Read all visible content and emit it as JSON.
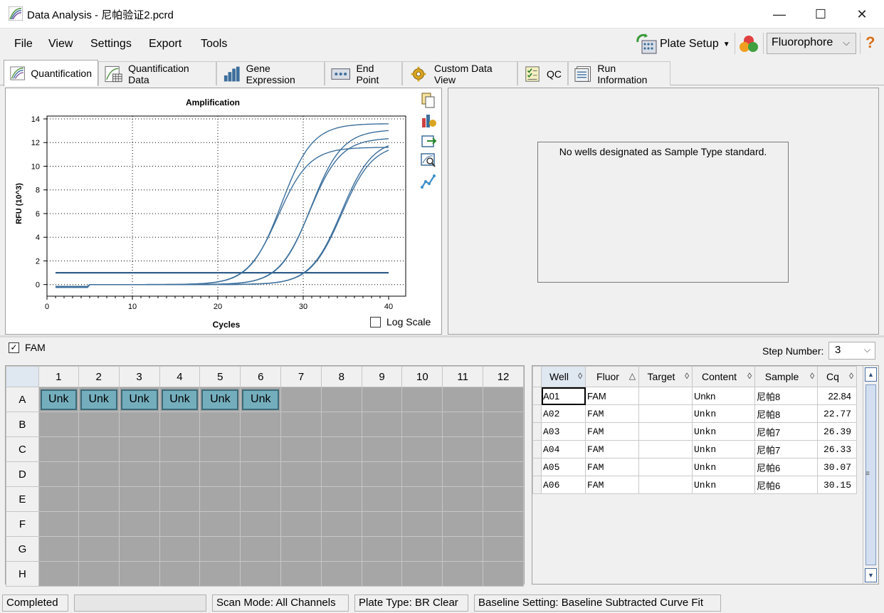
{
  "window": {
    "title": "Data Analysis - 尼帕验证2.pcrd",
    "minimize": "—",
    "maximize": "☐",
    "close": "✕"
  },
  "menu": [
    "File",
    "View",
    "Settings",
    "Export",
    "Tools"
  ],
  "toolbar": {
    "plate_setup_label": "Plate Setup",
    "fluor_select_value": "Fluorophore",
    "help_glyph": "?"
  },
  "tabs": [
    {
      "label": "Quantification",
      "active": true
    },
    {
      "label": "Quantification Data",
      "active": false
    },
    {
      "label": "Gene Expression",
      "active": false
    },
    {
      "label": "End Point",
      "active": false
    },
    {
      "label": "Custom Data View",
      "active": false
    },
    {
      "label": "QC",
      "active": false
    },
    {
      "label": "Run Information",
      "active": false
    }
  ],
  "chart_data": {
    "type": "line",
    "title": "Amplification",
    "xlabel": "Cycles",
    "ylabel": "RFU (10^3)",
    "xlim": [
      0,
      40
    ],
    "ylim": [
      -0.5,
      14
    ],
    "xticks": [
      0,
      10,
      20,
      30,
      40
    ],
    "yticks": [
      0,
      2,
      4,
      6,
      8,
      10,
      12,
      14
    ],
    "grid": true,
    "threshold": 1.0,
    "series_color": "#3d6f9c",
    "threshold_color": "#1f4f7f",
    "curve_params": [
      {
        "cq": 22.84,
        "plateau": 13.6
      },
      {
        "cq": 22.77,
        "plateau": 11.6
      },
      {
        "cq": 26.39,
        "plateau": 13.1
      },
      {
        "cq": 26.33,
        "plateau": 12.4
      },
      {
        "cq": 30.07,
        "plateau": 12.3
      },
      {
        "cq": 30.15,
        "plateau": 11.9
      }
    ]
  },
  "log_scale": {
    "label": "Log Scale",
    "checked": false
  },
  "standard_panel": {
    "message": "No wells designated as Sample Type standard."
  },
  "fluor_filter": {
    "label": "FAM",
    "checked": true,
    "check_glyph": "✓"
  },
  "step_number": {
    "label": "Step Number:",
    "value": "3"
  },
  "plate": {
    "columns": [
      "1",
      "2",
      "3",
      "4",
      "5",
      "6",
      "7",
      "8",
      "9",
      "10",
      "11",
      "12"
    ],
    "rows": [
      "A",
      "B",
      "C",
      "D",
      "E",
      "F",
      "G",
      "H"
    ],
    "wells": {
      "A1": "Unk",
      "A2": "Unk",
      "A3": "Unk",
      "A4": "Unk",
      "A5": "Unk",
      "A6": "Unk"
    }
  },
  "well_table": {
    "columns": [
      "Well",
      "Fluor",
      "Target",
      "Content",
      "Sample",
      "Cq"
    ],
    "rows": [
      {
        "well": "A01",
        "fluor": "FAM",
        "target": "",
        "content": "Unkn",
        "sample": "尼帕8",
        "cq": "22.84"
      },
      {
        "well": "A02",
        "fluor": "FAM",
        "target": "",
        "content": "Unkn",
        "sample": "尼帕8",
        "cq": "22.77"
      },
      {
        "well": "A03",
        "fluor": "FAM",
        "target": "",
        "content": "Unkn",
        "sample": "尼帕7",
        "cq": "26.39"
      },
      {
        "well": "A04",
        "fluor": "FAM",
        "target": "",
        "content": "Unkn",
        "sample": "尼帕7",
        "cq": "26.33"
      },
      {
        "well": "A05",
        "fluor": "FAM",
        "target": "",
        "content": "Unkn",
        "sample": "尼帕6",
        "cq": "30.07"
      },
      {
        "well": "A06",
        "fluor": "FAM",
        "target": "",
        "content": "Unkn",
        "sample": "尼帕6",
        "cq": "30.15"
      }
    ]
  },
  "status": {
    "state": "Completed",
    "scan_mode": "Scan Mode: All Channels",
    "plate_type": "Plate Type: BR Clear",
    "baseline": "Baseline Setting: Baseline Subtracted Curve Fit"
  }
}
